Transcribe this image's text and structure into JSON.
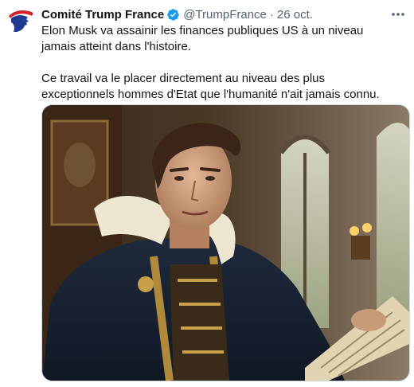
{
  "tweet": {
    "author_name": "Comité Trump France",
    "handle": "@TrumpFrance",
    "separator": "·",
    "date": "26 oct.",
    "paragraphs": [
      "Elon Musk va assainir les finances publiques US à un niveau jamais atteint dans l'histoire.",
      "Ce travail va le placer directement au niveau des plus exceptionnels hommes d'Etat que l'humanité n'ait jamais connu."
    ],
    "verified": true,
    "more_icon": "ellipsis-icon"
  },
  "colors": {
    "text": "#0f1419",
    "secondary": "#536471",
    "verified_blue": "#1d9bf0",
    "avatar_red": "#d3232b",
    "avatar_blue": "#1f3a93"
  }
}
